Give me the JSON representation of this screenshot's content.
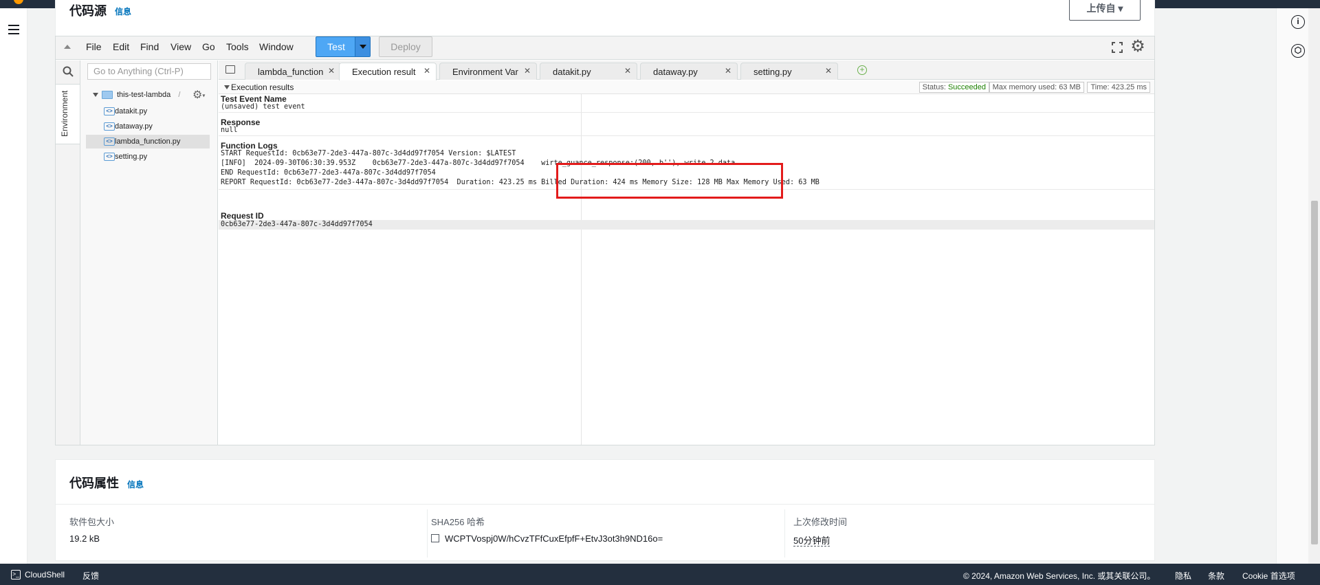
{
  "header": {
    "title": "代码源",
    "info_link": "信息",
    "upload_button": "上传自 ▾"
  },
  "ide": {
    "menus": [
      "File",
      "Edit",
      "Find",
      "View",
      "Go",
      "Tools",
      "Window"
    ],
    "test_button": "Test",
    "deploy_button": "Deploy",
    "goto_placeholder": "Go to Anything (Ctrl-P)",
    "environment_tab": "Environment",
    "tree": {
      "root": "this-test-lambda",
      "files": [
        "datakit.py",
        "dataway.py",
        "lambda_function.py",
        "setting.py"
      ],
      "active_file": "lambda_function.py"
    },
    "tabs": [
      "lambda_function",
      "Execution result",
      "Environment Var",
      "datakit.py",
      "dataway.py",
      "setting.py"
    ],
    "active_tab": "Execution result"
  },
  "execution": {
    "panel_label": "Execution results",
    "status_label": "Status:",
    "status_value": "Succeeded",
    "max_memory": "Max memory used: 63 MB",
    "time": "Time: 423.25 ms",
    "sections": {
      "event_name_title": "Test Event Name",
      "event_name_value": "(unsaved) test event",
      "response_title": "Response",
      "response_value": "null",
      "logs_title": "Function Logs",
      "log_lines": [
        "START RequestId: 0cb63e77-2de3-447a-807c-3d4dd97f7054 Version: $LATEST",
        "[INFO]  2024-09-30T06:30:39.953Z    0cb63e77-2de3-447a-807c-3d4dd97f7054    wirte_guance_response:(200, b''), write 2 data",
        "END RequestId: 0cb63e77-2de3-447a-807c-3d4dd97f7054",
        "REPORT RequestId: 0cb63e77-2de3-447a-807c-3d4dd97f7054  Duration: 423.25 ms Billed Duration: 424 ms Memory Size: 128 MB Max Memory Used: 63 MB"
      ],
      "request_id_title": "Request ID",
      "request_id_value": "0cb63e77-2de3-447a-807c-3d4dd97f7054"
    }
  },
  "properties": {
    "title": "代码属性",
    "info_link": "信息",
    "package_size_label": "软件包大小",
    "package_size_value": "19.2 kB",
    "sha_label": "SHA256 哈希",
    "sha_value": "WCPTVospj0W/hCvzTFfCuxEfpfF+EtvJ3ot3h9ND16o=",
    "modified_label": "上次修改时间",
    "modified_value": "50分钟前"
  },
  "footer": {
    "cloudshell": "CloudShell",
    "feedback": "反馈",
    "copyright": "© 2024, Amazon Web Services, Inc. 或其关联公司。",
    "privacy": "隐私",
    "terms": "条款",
    "cookie": "Cookie 首选项"
  },
  "colors": {
    "aws_navy": "#232f3e",
    "link_blue": "#0073bb",
    "test_blue": "#4ea7f5",
    "success_green": "#1d8102",
    "highlight_red": "#e31b1b"
  }
}
